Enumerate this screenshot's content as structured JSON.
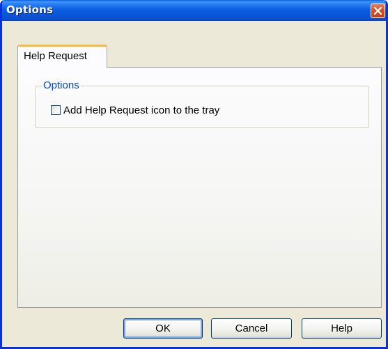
{
  "window": {
    "title": "Options"
  },
  "tabs": [
    {
      "label": "Help Request",
      "selected": true
    }
  ],
  "groupbox": {
    "legend": "Options",
    "checkbox": {
      "label": "Add Help Request icon to the tray",
      "checked": false
    }
  },
  "buttons": {
    "ok": "OK",
    "cancel": "Cancel",
    "help": "Help"
  },
  "colors": {
    "titlebar": "#0a5fdc",
    "close": "#d8542b",
    "group_legend": "#0046d5",
    "tab_highlight": "#f9b93c",
    "dialog_bg": "#ece9d8"
  },
  "icons": {
    "close": "close-icon"
  }
}
